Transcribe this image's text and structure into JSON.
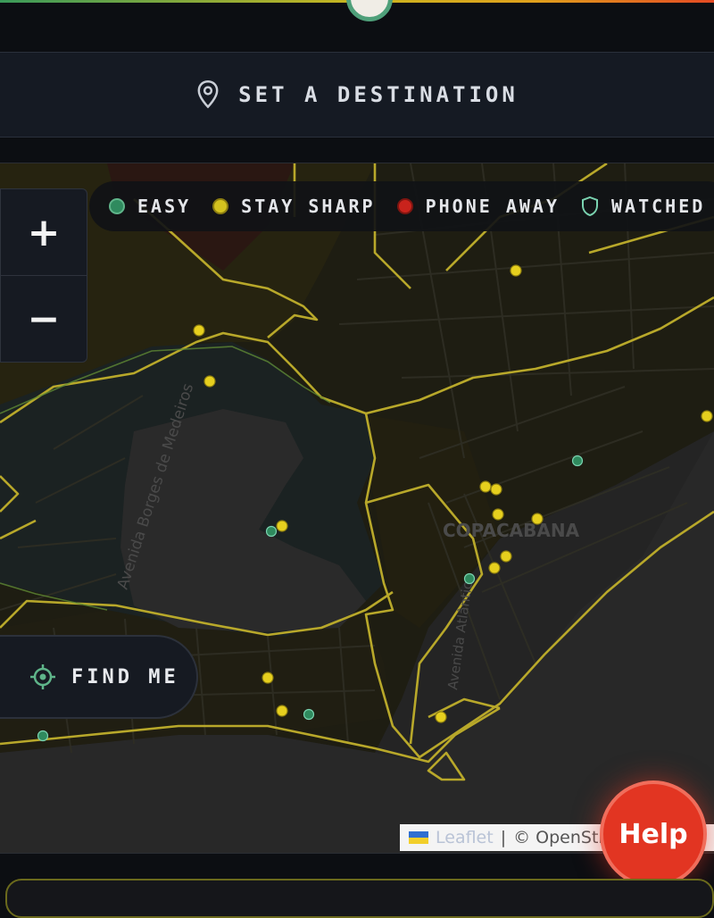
{
  "header": {
    "destination_label": "SET A DESTINATION"
  },
  "legend": [
    {
      "label": "EASY",
      "kind": "dot",
      "color": "#2f8a5e"
    },
    {
      "label": "STAY SHARP",
      "kind": "dot",
      "color": "#d4c21f"
    },
    {
      "label": "PHONE AWAY",
      "kind": "dot",
      "color": "#c9231c"
    },
    {
      "label": "WATCHED",
      "kind": "shield-icon",
      "color": "#7ad3b0"
    }
  ],
  "zoom": {
    "in_label": "+",
    "out_label": "−"
  },
  "find_me": {
    "label": "FIND ME"
  },
  "map": {
    "place_labels": [
      "COPACABANA"
    ],
    "street_labels": [
      "Avenida Borges de Medeiros",
      "Avenida Atlântica"
    ],
    "attribution": {
      "leaflet": "Leaflet",
      "separator": "|",
      "osm": "© OpenStree"
    }
  },
  "help": {
    "label": "Help"
  },
  "colors": {
    "easy": "#2f8a5e",
    "stay_sharp": "#d4c21f",
    "phone_away": "#c9231c",
    "boundary": "#b8a82a"
  }
}
